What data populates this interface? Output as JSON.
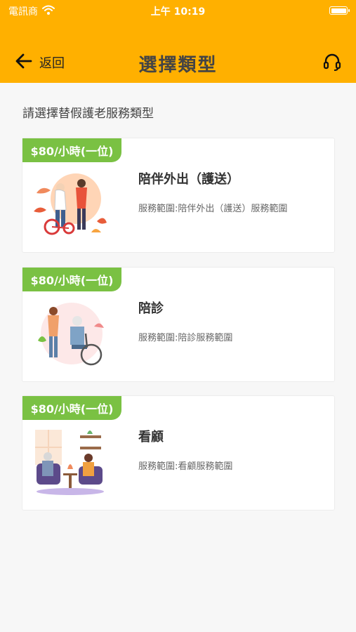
{
  "status_bar": {
    "carrier": "電訊商",
    "time": "上午 10:19"
  },
  "header": {
    "back_label": "返回",
    "title": "選擇類型",
    "background": "#ffb000"
  },
  "instruction": "請選擇替假護老服務類型",
  "services": [
    {
      "price": "$80/小時(一位)",
      "title": "陪伴外出（護送）",
      "description": "服務範圍:陪伴外出（護送）服務範圍"
    },
    {
      "price": "$80/小時(一位)",
      "title": "陪診",
      "description": "服務範圍:陪診服務範圍"
    },
    {
      "price": "$80/小時(一位)",
      "title": "看顧",
      "description": "服務範圍:看顧服務範圍"
    }
  ],
  "badge_color": "#7ac143",
  "icons": [
    "wifi-icon",
    "battery-icon",
    "back-arrow-icon",
    "headset-icon"
  ]
}
